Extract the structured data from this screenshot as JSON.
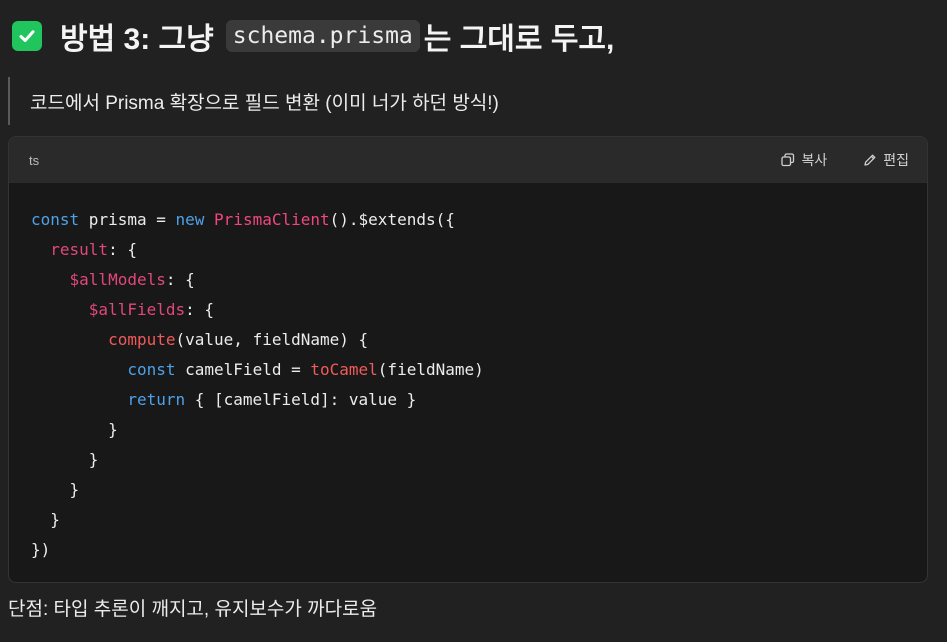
{
  "heading": {
    "check_icon": "check-square-icon",
    "before": "방법 3: 그냥",
    "code": "schema.prisma",
    "after": "는 그대로 두고,"
  },
  "quote": {
    "text": "코드에서 Prisma 확장으로 필드 변환 (이미 너가 하던 방식!)"
  },
  "code_block": {
    "language": "ts",
    "copy_label": "복사",
    "edit_label": "편집",
    "copy_icon": "copy-icon",
    "edit_icon": "pencil-icon",
    "lines": [
      [
        {
          "t": "const",
          "c": "kw"
        },
        {
          "t": " prisma = ",
          "c": ""
        },
        {
          "t": "new",
          "c": "kw"
        },
        {
          "t": " ",
          "c": ""
        },
        {
          "t": "PrismaClient",
          "c": "cls"
        },
        {
          "t": "().$extends({",
          "c": ""
        }
      ],
      [
        {
          "t": "  ",
          "c": ""
        },
        {
          "t": "result",
          "c": "prop"
        },
        {
          "t": ": {",
          "c": ""
        }
      ],
      [
        {
          "t": "    ",
          "c": ""
        },
        {
          "t": "$allModels",
          "c": "prop"
        },
        {
          "t": ": {",
          "c": ""
        }
      ],
      [
        {
          "t": "      ",
          "c": ""
        },
        {
          "t": "$allFields",
          "c": "prop"
        },
        {
          "t": ": {",
          "c": ""
        }
      ],
      [
        {
          "t": "        ",
          "c": ""
        },
        {
          "t": "compute",
          "c": "fn"
        },
        {
          "t": "(value, fieldName) {",
          "c": ""
        }
      ],
      [
        {
          "t": "          ",
          "c": ""
        },
        {
          "t": "const",
          "c": "kw"
        },
        {
          "t": " camelField = ",
          "c": ""
        },
        {
          "t": "toCamel",
          "c": "fn"
        },
        {
          "t": "(fieldName)",
          "c": ""
        }
      ],
      [
        {
          "t": "          ",
          "c": ""
        },
        {
          "t": "return",
          "c": "kw"
        },
        {
          "t": " { [camelField]: value }",
          "c": ""
        }
      ],
      [
        {
          "t": "        }",
          "c": ""
        }
      ],
      [
        {
          "t": "      }",
          "c": ""
        }
      ],
      [
        {
          "t": "    }",
          "c": ""
        }
      ],
      [
        {
          "t": "  }",
          "c": ""
        }
      ],
      [
        {
          "t": "})",
          "c": ""
        }
      ]
    ]
  },
  "footer": {
    "text": "단점: 타입 추론이 깨지고, 유지보수가 까다로움"
  },
  "colors": {
    "background": "#212121",
    "code_background": "#181818",
    "keyword": "#4ea1e8",
    "class": "#f0477d",
    "property": "#e1487a",
    "function": "#f15a5a",
    "check": "#21c55d"
  }
}
